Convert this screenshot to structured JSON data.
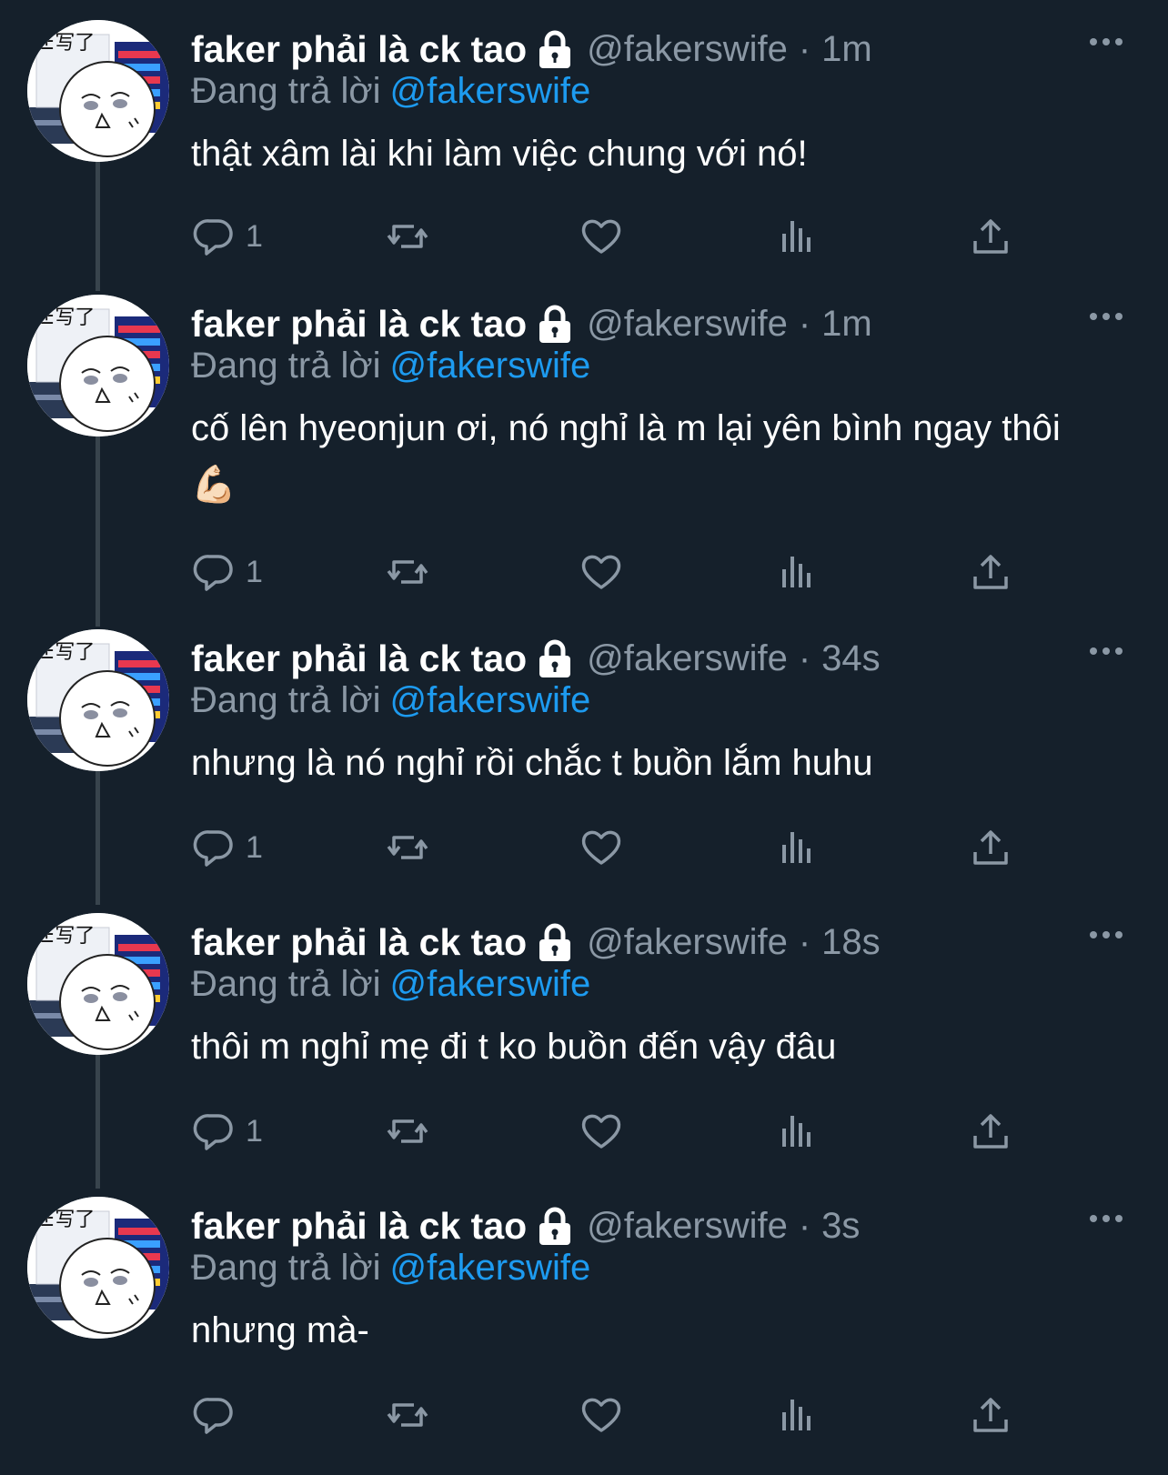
{
  "colors": {
    "background": "#15202b",
    "text_primary": "#ffffff",
    "text_secondary": "#8b98a5",
    "accent": "#1d9bf0",
    "thread_line": "#38444d"
  },
  "icons": {
    "reply": "speech-bubble-icon",
    "retweet": "retweet-arrows-icon",
    "like": "heart-outline-icon",
    "views": "bar-chart-icon",
    "share": "share-upload-icon",
    "more": "three-dots-icon",
    "locked": "lock-icon"
  },
  "tweets": [
    {
      "display_name": "faker phải là ck tao",
      "handle": "@fakerswife",
      "separator": "·",
      "time": "1m",
      "replying_prefix": "Đang trả lời",
      "replying_to": "@fakerswife",
      "text": "thật xâm lài khi làm việc chung với nó!",
      "reply_count": "1"
    },
    {
      "display_name": "faker phải là ck tao",
      "handle": "@fakerswife",
      "separator": "·",
      "time": "1m",
      "replying_prefix": "Đang trả lời",
      "replying_to": "@fakerswife",
      "text": "cố lên hyeonjun ơi, nó nghỉ là m lại yên bình ngay thôi 💪🏻",
      "reply_count": "1"
    },
    {
      "display_name": "faker phải là ck tao",
      "handle": "@fakerswife",
      "separator": "·",
      "time": "34s",
      "replying_prefix": "Đang trả lời",
      "replying_to": "@fakerswife",
      "text": "nhưng là nó nghỉ rồi chắc t buồn lắm huhu",
      "reply_count": "1"
    },
    {
      "display_name": "faker phải là ck tao",
      "handle": "@fakerswife",
      "separator": "·",
      "time": "18s",
      "replying_prefix": "Đang trả lời",
      "replying_to": "@fakerswife",
      "text": "thôi m nghỉ mẹ đi t ko buồn đến vậy đâu",
      "reply_count": "1"
    },
    {
      "display_name": "faker phải là ck tao",
      "handle": "@fakerswife",
      "separator": "·",
      "time": "3s",
      "replying_prefix": "Đang trả lời",
      "replying_to": "@fakerswife",
      "text": "nhưng mà-",
      "reply_count": ""
    }
  ]
}
